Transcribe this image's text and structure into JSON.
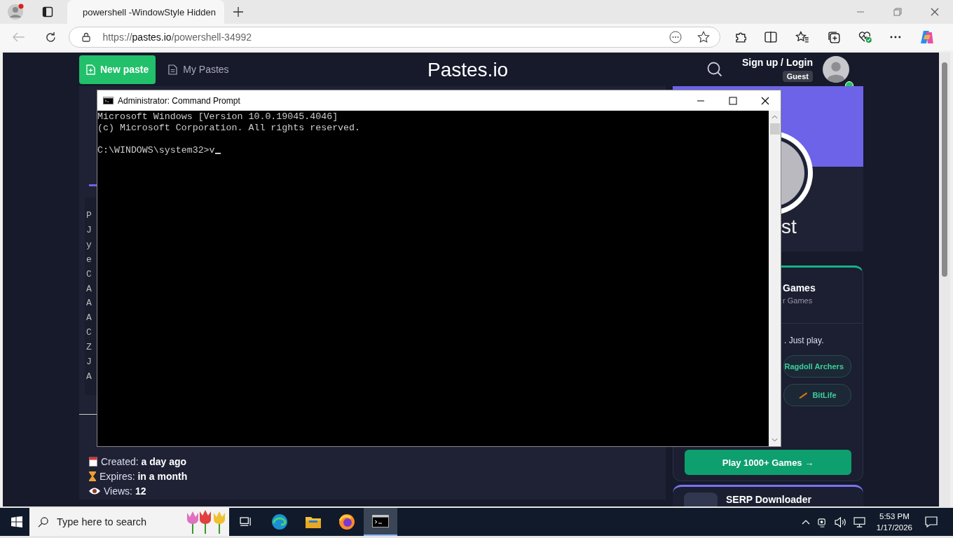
{
  "browser": {
    "tab_title": "powershell -WindowStyle Hidden",
    "url_scheme": "https://",
    "url_host": "pastes.io",
    "url_path": "/powershell-34992"
  },
  "site": {
    "new_paste": "New paste",
    "my_pastes": "My Pastes",
    "logo": "Pastes.io",
    "sign_in": "Sign up / Login",
    "guest_badge": "Guest"
  },
  "code_lines": [
    "P",
    "J",
    "y",
    "e",
    "C",
    "A",
    "A",
    "A",
    "C",
    "Z",
    "J",
    "A"
  ],
  "meta": [
    {
      "kind": "created",
      "label": "Created:",
      "value": "a day ago"
    },
    {
      "kind": "expires",
      "label": "Expires:",
      "value": "in a month"
    },
    {
      "kind": "views",
      "label": "Views:",
      "value": "12"
    }
  ],
  "profile": {
    "name": "st"
  },
  "games": {
    "title": "Games",
    "subtitle": "r Games",
    "tagline": ". Just play.",
    "chips": [
      {
        "label": "Ragdoll Archers",
        "kind": "plain"
      },
      {
        "label": "BitLife",
        "kind": "icon"
      }
    ],
    "play_button": "Play 1000+ Games →"
  },
  "serp": {
    "title": "SERP Downloader"
  },
  "cmd": {
    "title": "Administrator: Command Prompt",
    "banner": [
      "Microsoft Windows [Version 10.0.19045.4046]",
      "(c) Microsoft Corporation. All rights reserved."
    ],
    "prompt": "C:\\WINDOWS\\system32>v"
  },
  "taskbar": {
    "search_placeholder": "Type here to search",
    "apps": [
      {
        "kind": "taskview",
        "selected": false
      },
      {
        "kind": "edge",
        "selected": false
      },
      {
        "kind": "explorer",
        "selected": false
      },
      {
        "kind": "firefox",
        "selected": false
      },
      {
        "kind": "cmd",
        "selected": true
      }
    ],
    "time": "5:53 PM",
    "date": "1/17/2026"
  }
}
